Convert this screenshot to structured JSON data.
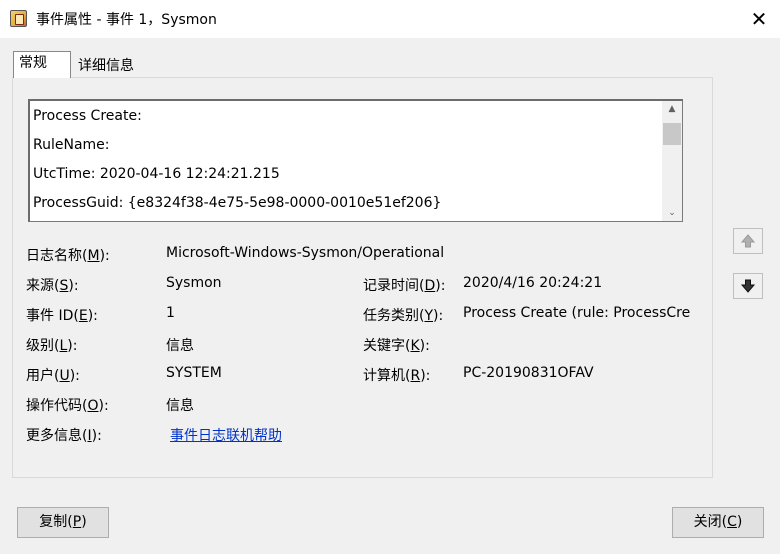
{
  "window": {
    "title": "事件属性 - 事件 1，Sysmon",
    "close_glyph": "✕"
  },
  "tabs": [
    {
      "label": "常规",
      "active": true
    },
    {
      "label": "详细信息",
      "active": false
    }
  ],
  "details": {
    "lines": [
      "Process Create:",
      "RuleName:",
      "UtcTime: 2020-04-16 12:24:21.215",
      "ProcessGuid: {e8324f38-4e75-5e98-0000-0010e51ef206}"
    ],
    "scroll_up_glyph": "▲",
    "scroll_down_glyph": "⌄"
  },
  "fields": {
    "log_name": {
      "label_prefix": "日志名称(",
      "label_key": "M",
      "label_suffix": "):",
      "value": "Microsoft-Windows-Sysmon/Operational"
    },
    "source": {
      "label_prefix": "来源(",
      "label_key": "S",
      "label_suffix": "):",
      "value": "Sysmon"
    },
    "logged": {
      "label_prefix": "记录时间(",
      "label_key": "D",
      "label_suffix": "):",
      "value": "2020/4/16 20:24:21"
    },
    "event_id": {
      "label_prefix": "事件 ID(",
      "label_key": "E",
      "label_suffix": "):",
      "value": "1"
    },
    "task_category": {
      "label_prefix": "任务类别(",
      "label_key": "Y",
      "label_suffix": "):",
      "value": "Process Create (rule: ProcessCreat"
    },
    "level": {
      "label_prefix": "级别(",
      "label_key": "L",
      "label_suffix": "):",
      "value": "信息"
    },
    "keywords": {
      "label_prefix": "关键字(",
      "label_key": "K",
      "label_suffix": "):",
      "value": ""
    },
    "user": {
      "label_prefix": "用户(",
      "label_key": "U",
      "label_suffix": "):",
      "value": "SYSTEM"
    },
    "computer": {
      "label_prefix": "计算机(",
      "label_key": "R",
      "label_suffix": "):",
      "value": "PC-20190831OFAV"
    },
    "opcode": {
      "label_prefix": "操作代码(",
      "label_key": "O",
      "label_suffix": "):",
      "value": "信息"
    },
    "more_info": {
      "label_prefix": "更多信息(",
      "label_key": "I",
      "label_suffix": "):",
      "value": "事件日志联机帮助"
    }
  },
  "side": {
    "up_icon": "arrow-up-icon",
    "down_icon": "arrow-down-icon"
  },
  "buttons": {
    "copy": {
      "prefix": "复制(",
      "key": "P",
      "suffix": ")"
    },
    "close": {
      "prefix": "关闭(",
      "key": "C",
      "suffix": ")"
    }
  }
}
